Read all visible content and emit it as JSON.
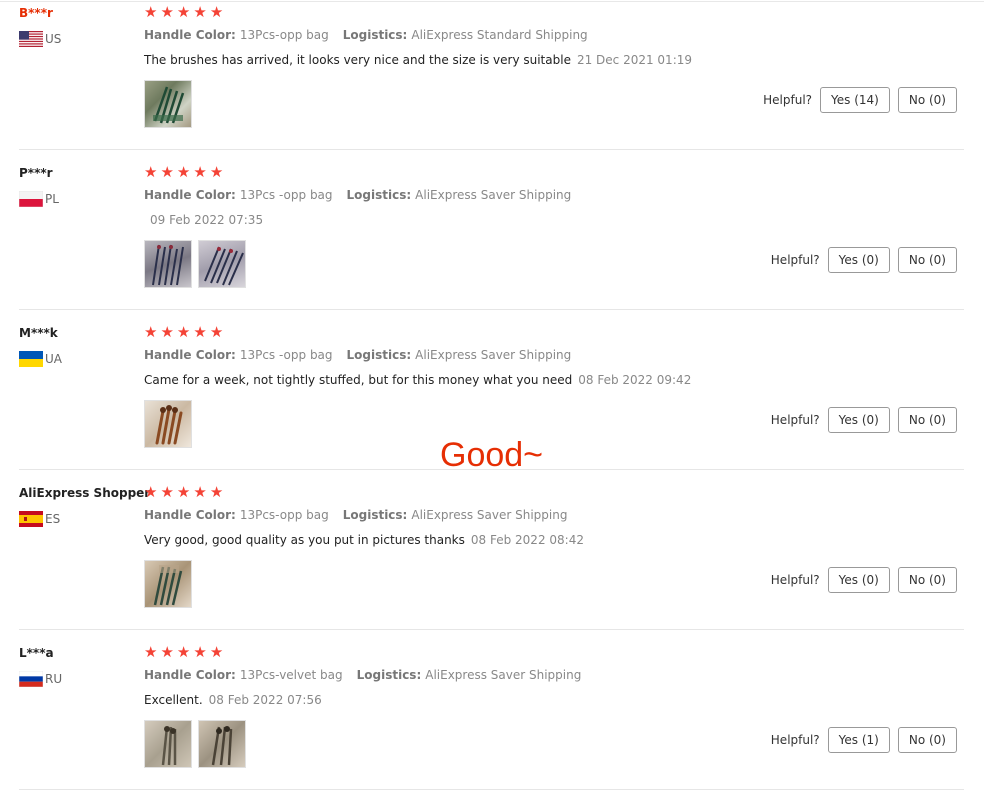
{
  "labels": {
    "handle_color": "Handle Color:",
    "logistics": "Logistics:",
    "helpful": "Helpful?"
  },
  "overlay_text": "Good~",
  "reviews": [
    {
      "name": "B***r",
      "name_color": "#e62e04",
      "country": "US",
      "flag": "flag-us-icon",
      "rating": 5,
      "handle_color": "13Pcs-opp bag",
      "logistics": "AliExpress Standard Shipping",
      "text": "The brushes has arrived, it looks very nice and the size is very suitable",
      "date": "21 Dec 2021 01:19",
      "photos": 1,
      "yes": "Yes (14)",
      "no": "No (0)"
    },
    {
      "name": "P***r",
      "name_color": "#222222",
      "country": "PL",
      "flag": "flag-pl-icon",
      "rating": 5,
      "handle_color": "13Pcs -opp bag",
      "logistics": "AliExpress Saver Shipping",
      "text": "",
      "date": "09 Feb 2022 07:35",
      "photos": 2,
      "yes": "Yes (0)",
      "no": "No (0)"
    },
    {
      "name": "M***k",
      "name_color": "#222222",
      "country": "UA",
      "flag": "flag-ua-icon",
      "rating": 5,
      "handle_color": "13Pcs -opp bag",
      "logistics": "AliExpress Saver Shipping",
      "text": "Came for a week, not tightly stuffed, but for this money what you need",
      "date": "08 Feb 2022 09:42",
      "photos": 1,
      "yes": "Yes (0)",
      "no": "No (0)"
    },
    {
      "name": "AliExpress Shopper",
      "name_color": "#222222",
      "country": "ES",
      "flag": "flag-es-icon",
      "rating": 5,
      "handle_color": "13Pcs-opp bag",
      "logistics": "AliExpress Saver Shipping",
      "text": "Very good, good quality as you put in pictures thanks",
      "date": "08 Feb 2022 08:42",
      "photos": 1,
      "yes": "Yes (0)",
      "no": "No (0)"
    },
    {
      "name": "L***a",
      "name_color": "#222222",
      "country": "RU",
      "flag": "flag-ru-icon",
      "rating": 5,
      "handle_color": "13Pcs-velvet bag",
      "logistics": "AliExpress Saver Shipping",
      "text": "Excellent.",
      "date": "08 Feb 2022 07:56",
      "photos": 2,
      "yes": "Yes (1)",
      "no": "No (0)"
    }
  ]
}
